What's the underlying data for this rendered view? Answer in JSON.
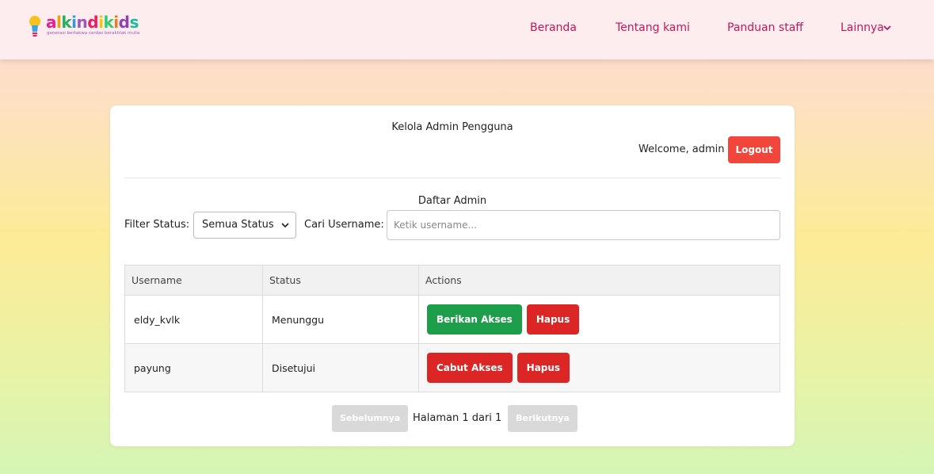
{
  "brand": {
    "name_parts": [
      "a",
      "l",
      "k",
      "i",
      "n",
      "d",
      "i",
      "k",
      "i",
      "d",
      "s"
    ],
    "name_colors": [
      "#e91e8c",
      "#f39c12",
      "#27ae60",
      "#3498db",
      "#9b59b6",
      "#e91e63",
      "#f1c40f",
      "#2ecc71",
      "#e67e22",
      "#8e44ad",
      "#1abc9c"
    ],
    "tagline": "generasi bertakwa cerdas berakhlak mulia",
    "bulb_icon": "lightbulb-icon"
  },
  "nav": {
    "items": [
      {
        "label": "Beranda"
      },
      {
        "label": "Tentang kami"
      },
      {
        "label": "Panduan staff"
      },
      {
        "label": "Lainnya"
      }
    ],
    "dropdown_icon": "chevron-down-icon"
  },
  "page": {
    "title": "Kelola Admin Pengguna",
    "welcome": "Welcome, admin |",
    "logout_label": "Logout",
    "section_title": "Daftar Admin",
    "filter_label": "Filter Status:",
    "filter_value": "Semua Status",
    "search_label": "Cari Username:",
    "search_placeholder": "Ketik username..."
  },
  "table": {
    "headers": [
      "Username",
      "Status",
      "Actions"
    ],
    "rows": [
      {
        "username": "eldy_kvlk",
        "status": "Menunggu",
        "primary_action": "Berikan Akses",
        "primary_color": "#1e9e4a",
        "delete_label": "Hapus"
      },
      {
        "username": "payung",
        "status": "Disetujui",
        "primary_action": "Cabut Akses",
        "primary_color": "#dc2626",
        "delete_label": "Hapus"
      }
    ]
  },
  "pagination": {
    "prev_label": "Sebelumnya",
    "info": "Halaman 1 dari 1",
    "next_label": "Berikutnya"
  },
  "colors": {
    "accent": "#c2185b",
    "logout": "#f2453b",
    "approve": "#1e9e4a",
    "danger": "#dc2626"
  }
}
